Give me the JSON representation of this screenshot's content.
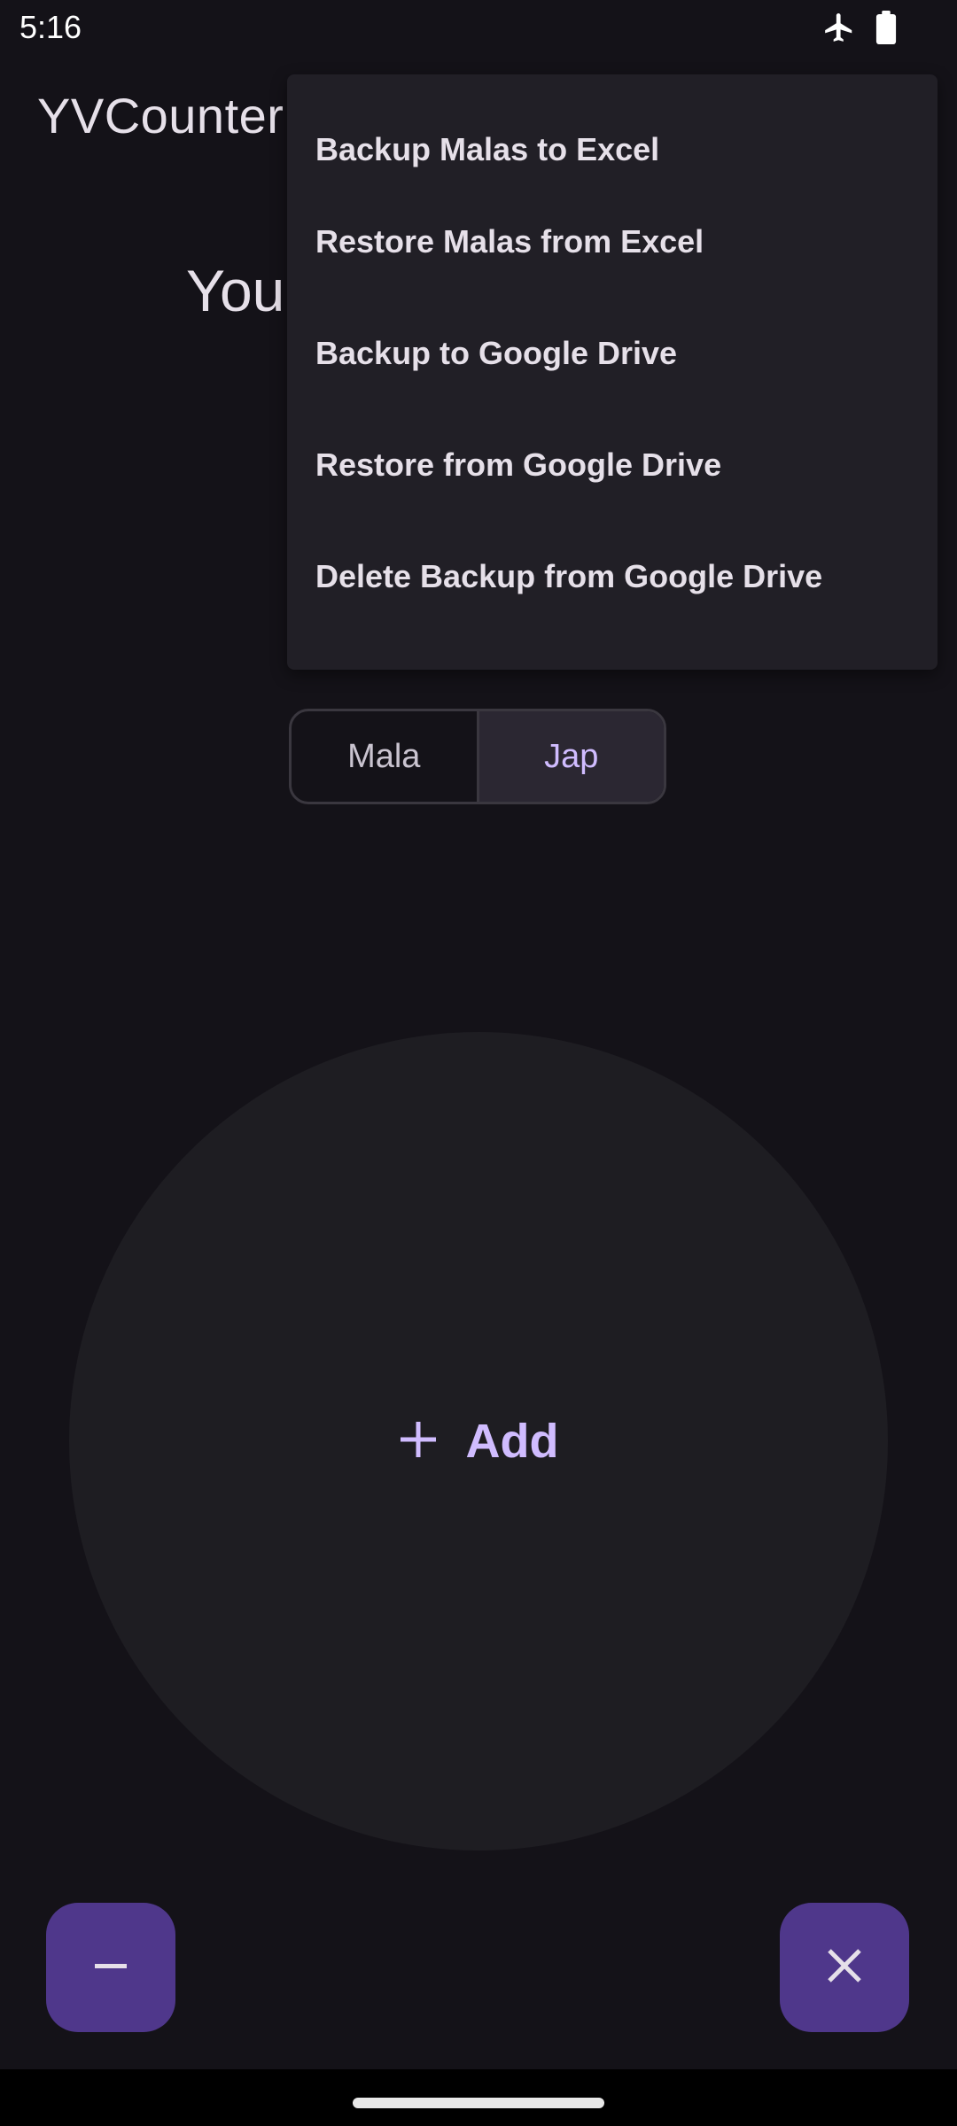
{
  "status_bar": {
    "time": "5:16",
    "icons": [
      "airplane-mode-icon",
      "battery-icon"
    ]
  },
  "app_bar": {
    "title": "YVCounter"
  },
  "main": {
    "heading_visible": "Your",
    "segmented": {
      "options": [
        "Mala",
        "Jap"
      ],
      "selected": "Jap"
    },
    "add_button": {
      "label": "Add",
      "icon": "plus-icon"
    },
    "fab_left_icon": "minus-icon",
    "fab_right_icon": "close-icon"
  },
  "popup_menu": {
    "items": [
      "Backup Malas to Excel",
      "Restore Malas from Excel",
      "Backup to Google Drive",
      "Restore from Google Drive",
      "Delete Backup from Google Drive"
    ]
  },
  "colors": {
    "background": "#141218",
    "surface": "#211f26",
    "circle": "#1e1d22",
    "accent": "#d0bcff",
    "fab": "#4f378b"
  }
}
